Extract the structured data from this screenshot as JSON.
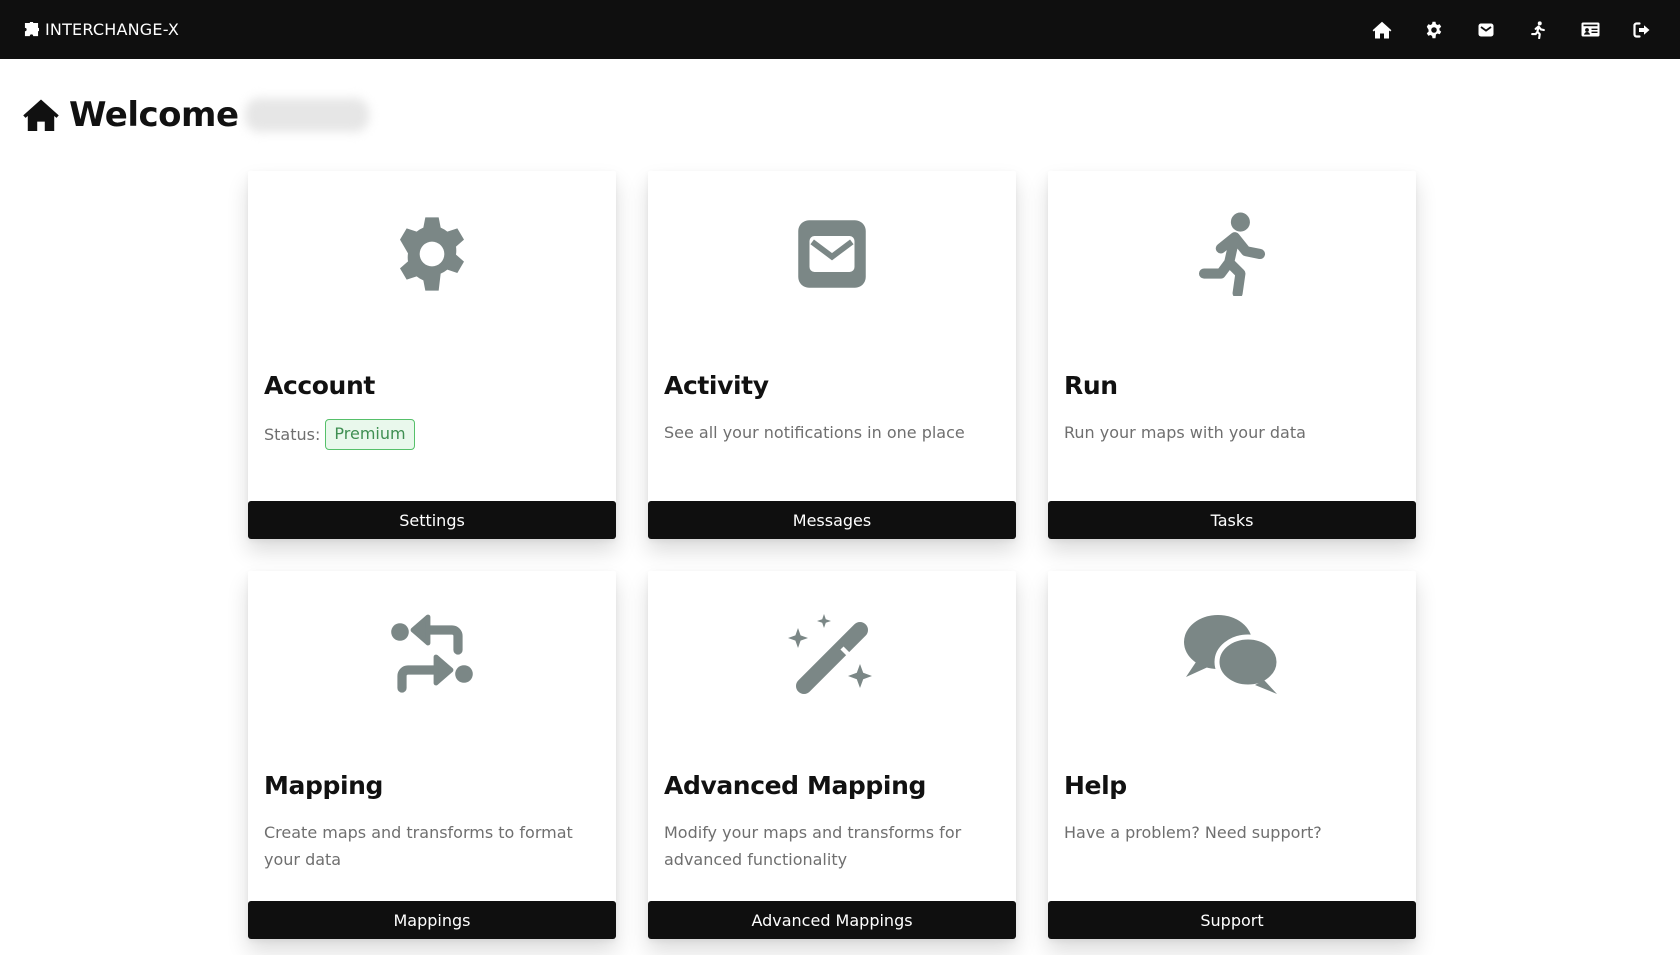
{
  "app": {
    "brand": "INTERCHANGE-X",
    "brand_icon": "puzzle-icon"
  },
  "nav": {
    "icons": [
      "home-icon",
      "gear-icon",
      "envelope-icon",
      "running-icon",
      "id-card-icon",
      "logout-icon"
    ]
  },
  "welcome": {
    "title": "Welcome",
    "icon": "home-icon"
  },
  "colors": {
    "topbar": "#0f0f0f",
    "icon_gray": "#7b8786",
    "badge_border": "#56c06a",
    "badge_bg": "#e9f8ec",
    "badge_text": "#3f8f52"
  },
  "cards": [
    {
      "title": "Account",
      "icon": "gear-icon",
      "status_label": "Status:",
      "status_badge": "Premium",
      "button": "Settings"
    },
    {
      "title": "Activity",
      "icon": "envelope-icon",
      "description": "See all your notifications in one place",
      "button": "Messages"
    },
    {
      "title": "Run",
      "icon": "running-icon",
      "description": "Run your maps with your data",
      "button": "Tasks"
    },
    {
      "title": "Mapping",
      "icon": "transform-arrows-icon",
      "description": "Create maps and transforms to format your data",
      "button": "Mappings"
    },
    {
      "title": "Advanced Mapping",
      "icon": "magic-wand-icon",
      "description": "Modify your maps and transforms for advanced functionality",
      "button": "Advanced Mappings"
    },
    {
      "title": "Help",
      "icon": "chat-bubbles-icon",
      "description": "Have a problem? Need support?",
      "button": "Support"
    }
  ]
}
